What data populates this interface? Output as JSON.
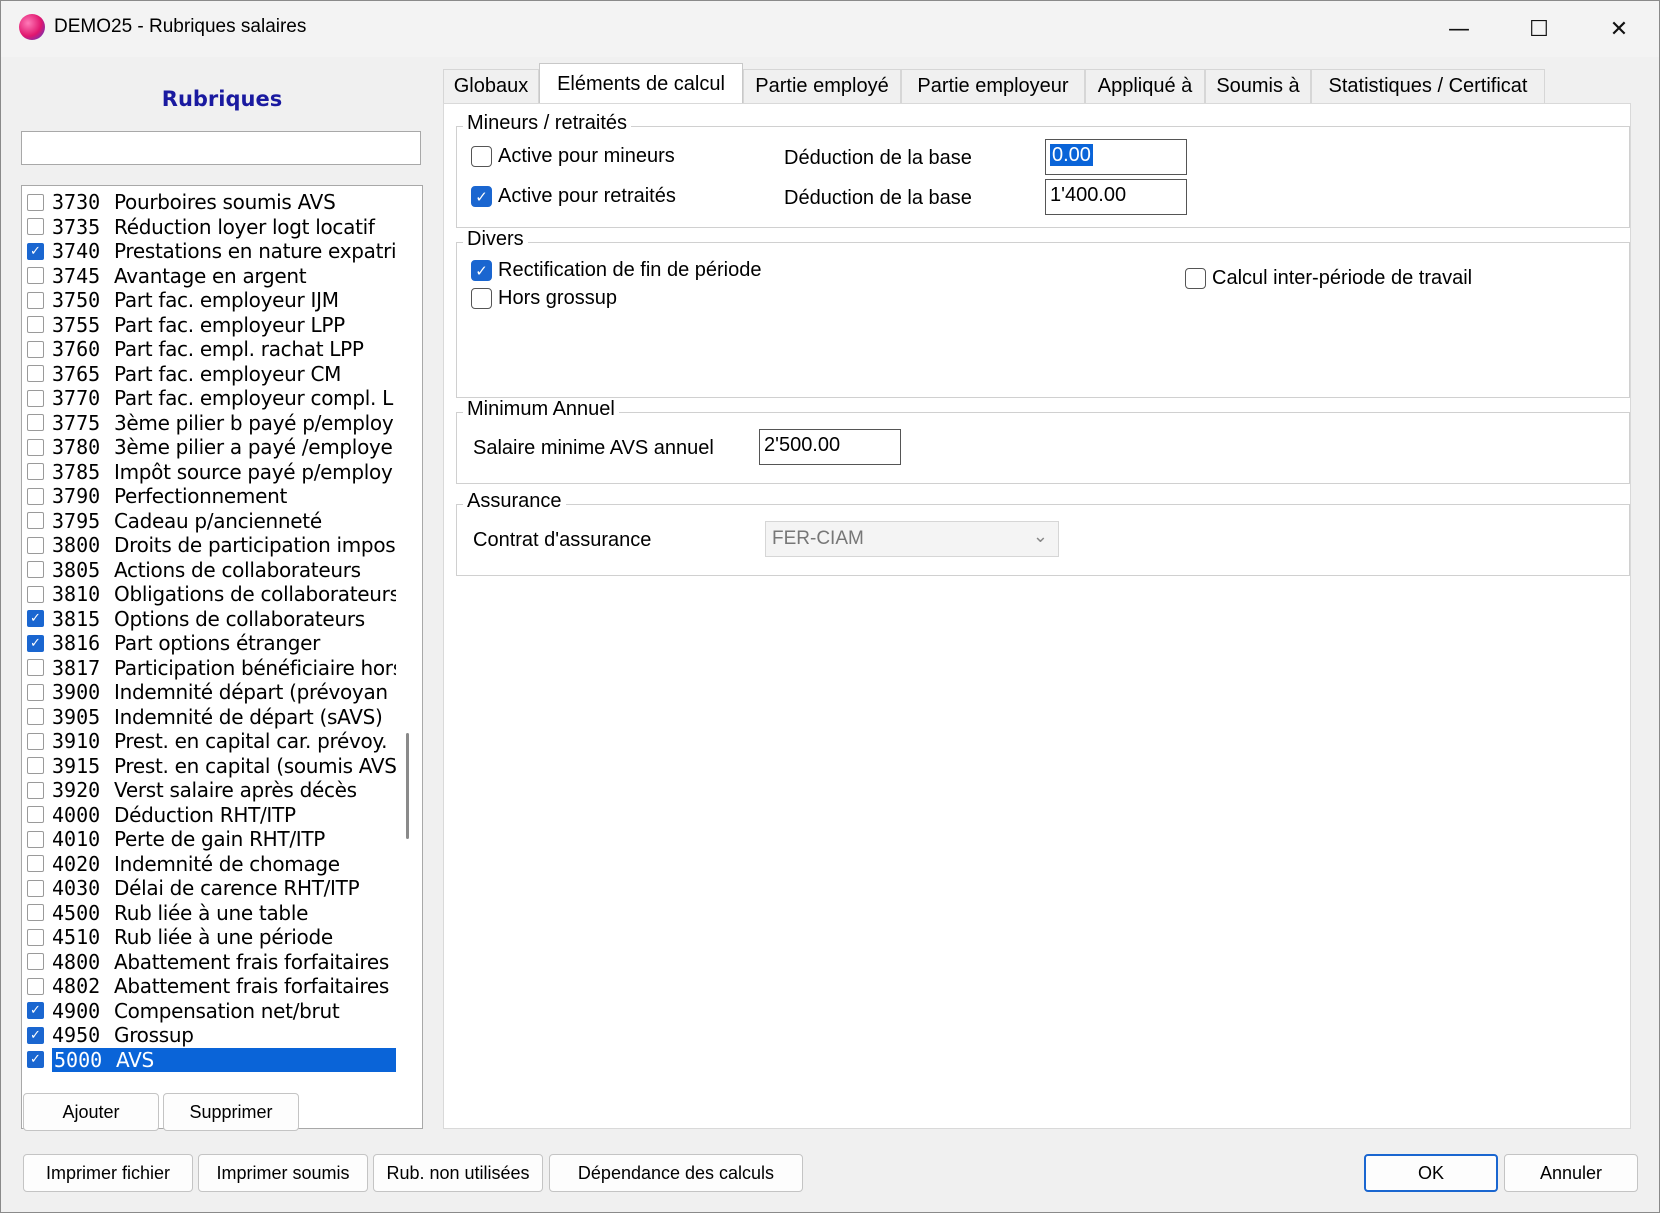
{
  "window": {
    "title": "DEMO25 - Rubriques salaires",
    "minimize": "—",
    "maximize": "☐",
    "close": "✕"
  },
  "left": {
    "heading": "Rubriques",
    "search_value": "",
    "items": [
      {
        "code": "3730",
        "label": "Pourboires soumis AVS",
        "checked": false
      },
      {
        "code": "3735",
        "label": "Réduction loyer logt locatif",
        "checked": false
      },
      {
        "code": "3740",
        "label": "Prestations en nature expatri",
        "checked": true
      },
      {
        "code": "3745",
        "label": "Avantage en argent",
        "checked": false
      },
      {
        "code": "3750",
        "label": "Part fac. employeur IJM",
        "checked": false
      },
      {
        "code": "3755",
        "label": "Part fac. employeur LPP",
        "checked": false
      },
      {
        "code": "3760",
        "label": "Part fac. empl. rachat LPP",
        "checked": false
      },
      {
        "code": "3765",
        "label": "Part fac. employeur CM",
        "checked": false
      },
      {
        "code": "3770",
        "label": "Part fac. employeur compl. L",
        "checked": false
      },
      {
        "code": "3775",
        "label": "3ème pilier b payé p/employ",
        "checked": false
      },
      {
        "code": "3780",
        "label": "3ème pilier a payé /employe",
        "checked": false
      },
      {
        "code": "3785",
        "label": "Impôt source payé p/employ",
        "checked": false
      },
      {
        "code": "3790",
        "label": "Perfectionnement",
        "checked": false
      },
      {
        "code": "3795",
        "label": "Cadeau p/ancienneté",
        "checked": false
      },
      {
        "code": "3800",
        "label": "Droits de participation impos",
        "checked": false
      },
      {
        "code": "3805",
        "label": "Actions de collaborateurs",
        "checked": false
      },
      {
        "code": "3810",
        "label": "Obligations de collaborateurs",
        "checked": false
      },
      {
        "code": "3815",
        "label": "Options de collaborateurs",
        "checked": true
      },
      {
        "code": "3816",
        "label": "Part options étranger",
        "checked": true
      },
      {
        "code": "3817",
        "label": "Participation bénéficiaire hors",
        "checked": false
      },
      {
        "code": "3900",
        "label": "Indemnité départ (prévoyan",
        "checked": false
      },
      {
        "code": "3905",
        "label": "Indemnité de départ (sAVS)",
        "checked": false
      },
      {
        "code": "3910",
        "label": "Prest. en capital car. prévoy.",
        "checked": false
      },
      {
        "code": "3915",
        "label": "Prest. en capital (soumis AVS",
        "checked": false
      },
      {
        "code": "3920",
        "label": "Verst salaire après décès",
        "checked": false
      },
      {
        "code": "4000",
        "label": "Déduction RHT/ITP",
        "checked": false
      },
      {
        "code": "4010",
        "label": "Perte de gain RHT/ITP",
        "checked": false
      },
      {
        "code": "4020",
        "label": "Indemnité de chomage",
        "checked": false
      },
      {
        "code": "4030",
        "label": "Délai de carence RHT/ITP",
        "checked": false
      },
      {
        "code": "4500",
        "label": "Rub liée à une table",
        "checked": false
      },
      {
        "code": "4510",
        "label": "Rub liée à une période",
        "checked": false
      },
      {
        "code": "4800",
        "label": "Abattement frais forfaitaires",
        "checked": false
      },
      {
        "code": "4802",
        "label": "Abattement frais forfaitaires",
        "checked": false
      },
      {
        "code": "4900",
        "label": "Compensation net/brut",
        "checked": true
      },
      {
        "code": "4950",
        "label": "Grossup",
        "checked": true
      },
      {
        "code": "5000",
        "label": "AVS",
        "checked": true,
        "selected": true
      }
    ],
    "add_button": "Ajouter",
    "delete_button": "Supprimer"
  },
  "tabs": [
    {
      "label": "Globaux"
    },
    {
      "label": "Eléments de calcul",
      "active": true
    },
    {
      "label": "Partie employé"
    },
    {
      "label": "Partie employeur"
    },
    {
      "label": "Appliqué à"
    },
    {
      "label": "Soumis à"
    },
    {
      "label": "Statistiques / Certificat"
    }
  ],
  "mineurs": {
    "group_title": "Mineurs / retraités",
    "active_mineurs_label": "Active pour mineurs",
    "active_mineurs_checked": false,
    "active_retraites_label": "Active pour retraités",
    "active_retraites_checked": true,
    "deduction_label_1": "Déduction de la base",
    "deduction_value_1": "0.00",
    "deduction_label_2": "Déduction de la base",
    "deduction_value_2": "1'400.00"
  },
  "divers": {
    "group_title": "Divers",
    "rectification_label": "Rectification de fin de période",
    "rectification_checked": true,
    "hors_grossup_label": "Hors grossup",
    "hors_grossup_checked": false,
    "inter_periode_label": "Calcul inter-période de travail",
    "inter_periode_checked": false
  },
  "minimum": {
    "group_title": "Minimum Annuel",
    "salaire_label": "Salaire minime AVS annuel",
    "salaire_value": "2'500.00"
  },
  "assurance": {
    "group_title": "Assurance",
    "contrat_label": "Contrat d'assurance",
    "contrat_value": "FER-CIAM"
  },
  "bottom": {
    "print_file": "Imprimer fichier",
    "print_soumis": "Imprimer soumis",
    "unused": "Rub. non utilisées",
    "dependance": "Dépendance des calculs",
    "ok": "OK",
    "cancel": "Annuler"
  },
  "colors": {
    "accent": "#1a66d0",
    "selection": "#0a64d8",
    "heading": "#1a1aa0"
  }
}
